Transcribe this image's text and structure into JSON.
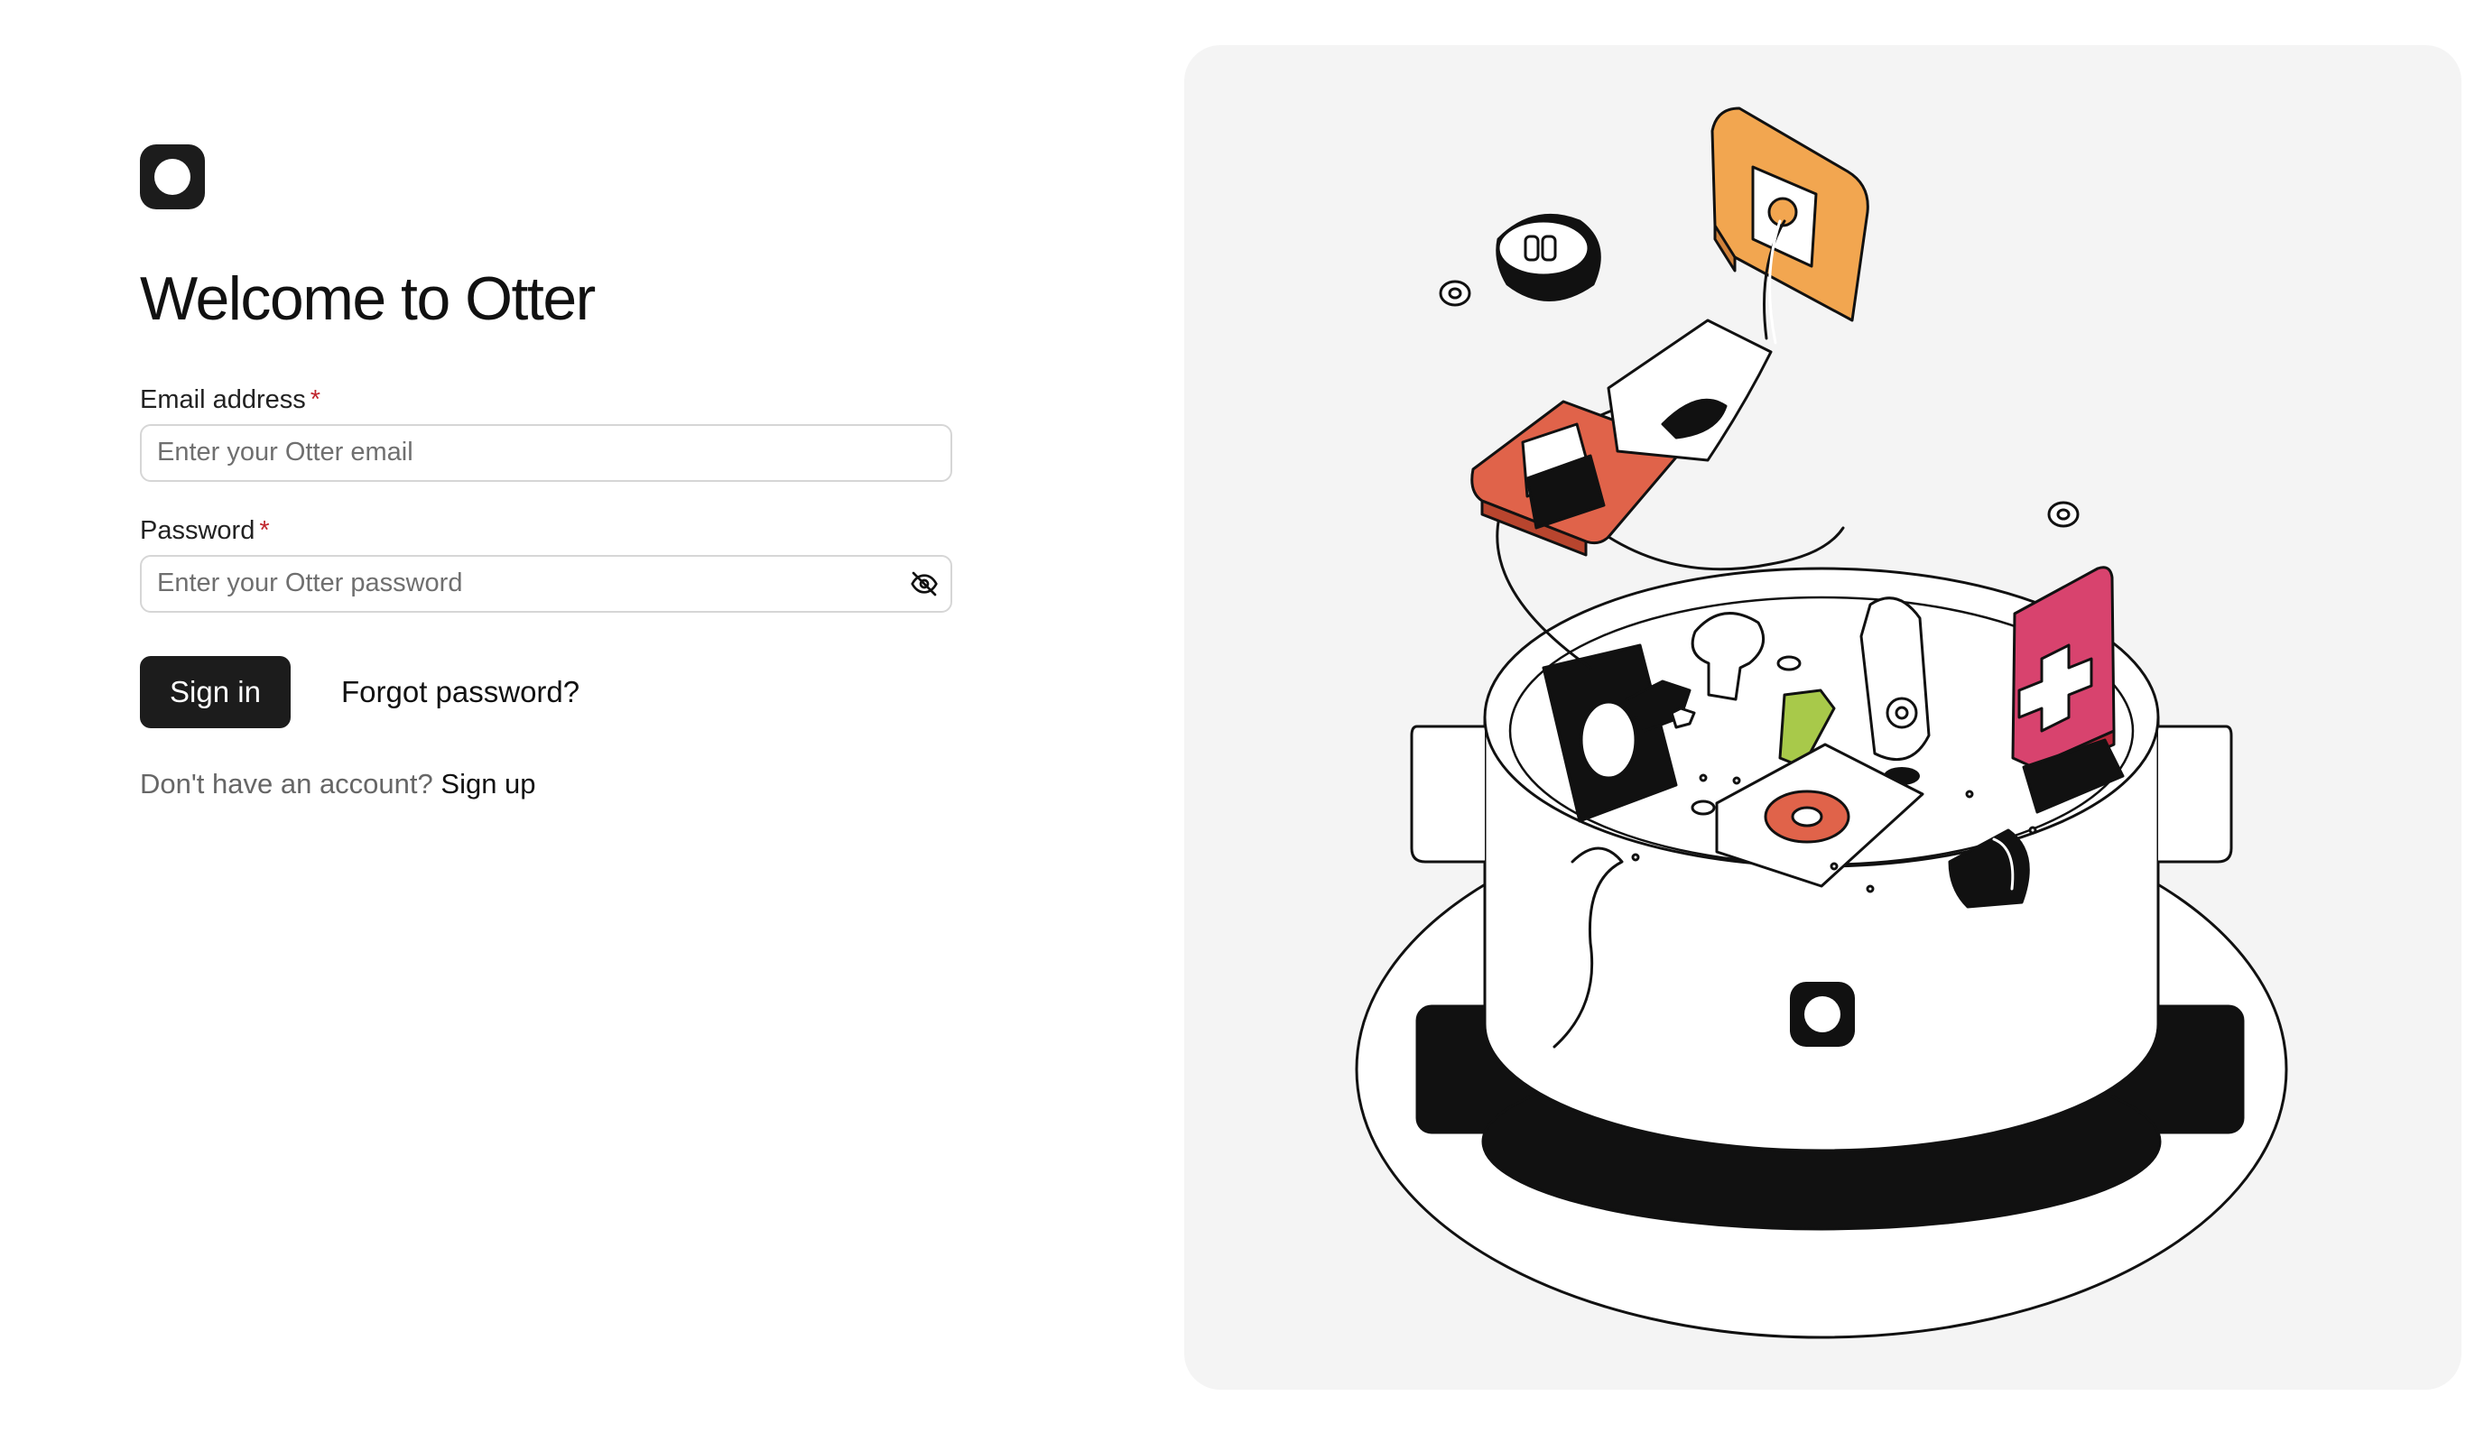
{
  "login": {
    "title": "Welcome to Otter",
    "email": {
      "label": "Email address",
      "required_mark": "*",
      "placeholder": "Enter your Otter email",
      "value": ""
    },
    "password": {
      "label": "Password",
      "required_mark": "*",
      "placeholder": "Enter your Otter password",
      "value": "",
      "toggle_icon": "eye-off-icon"
    },
    "sign_in_label": "Sign in",
    "forgot_label": "Forgot password?",
    "signup_prompt": "Don't have an account?",
    "signup_label": "Sign up"
  },
  "brand": {
    "logo_icon": "otter-logo-icon",
    "primary_color": "#1c1c1c"
  },
  "illustration": {
    "description_icon": "cooking-pot-illustration",
    "panel_color": "#f4f4f4",
    "tile_colors": {
      "orange": "#f2a650",
      "coral": "#e0634a",
      "pink": "#d8436e",
      "red_marker": "#e0634a",
      "green": "#a8c94a"
    }
  }
}
